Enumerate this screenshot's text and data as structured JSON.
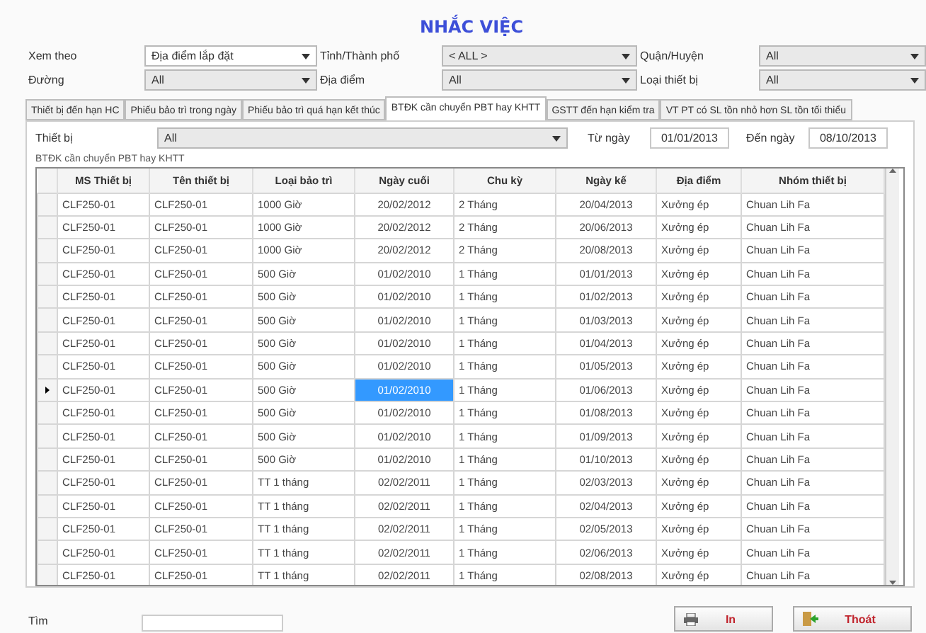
{
  "title": "NHẮC VIỆC",
  "filters": [
    {
      "label": "Xem theo",
      "value": "Địa điểm lắp đặt",
      "editable": true
    },
    {
      "label": "Tỉnh/Thành phố",
      "value": "< ALL >",
      "editable": false
    },
    {
      "label": "Quận/Huyện",
      "value": "All",
      "editable": false
    },
    {
      "label": "Đường",
      "value": "All",
      "editable": false
    },
    {
      "label": "Địa điểm",
      "value": "All",
      "editable": false
    },
    {
      "label": "Loại thiết bị",
      "value": "All",
      "editable": false
    }
  ],
  "tabs": [
    {
      "label": "Thiết bị đến hạn HC",
      "selected": false
    },
    {
      "label": "Phiếu bảo trì trong ngày",
      "selected": false
    },
    {
      "label": "Phiếu bảo trì quá hạn kết thúc",
      "selected": false
    },
    {
      "label": "BTĐK cần chuyển PBT hay KHTT",
      "selected": true
    },
    {
      "label": "GSTT đến hạn kiểm tra",
      "selected": false
    },
    {
      "label": "VT PT có SL tồn nhỏ hơn SL tồn tối thiểu",
      "selected": false
    }
  ],
  "panel": {
    "device_label": "Thiết bị",
    "device_value": "All",
    "from_label": "Từ ngày",
    "from_value": "01/01/2013",
    "to_label": "Đến ngày",
    "to_value": "08/10/2013",
    "group_label": "BTĐK cần chuyển PBT hay KHTT"
  },
  "table": {
    "columns": [
      {
        "label": "MS Thiết bị",
        "focused": false
      },
      {
        "label": "Tên thiết bị",
        "focused": false
      },
      {
        "label": "Loại bảo trì",
        "focused": false
      },
      {
        "label": "Ngày cuối",
        "focused": true
      },
      {
        "label": "Chu kỳ",
        "focused": false
      },
      {
        "label": "Ngày kế",
        "focused": false
      },
      {
        "label": "Địa điểm",
        "focused": false
      },
      {
        "label": "Nhóm thiết bị",
        "focused": false
      }
    ],
    "rows": [
      {
        "cells": [
          "CLF250-01",
          "CLF250-01",
          "1000 Giờ",
          "20/02/2012",
          "2 Tháng",
          "20/04/2013",
          "Xưởng ép",
          "Chuan Lih Fa"
        ],
        "selected": false
      },
      {
        "cells": [
          "CLF250-01",
          "CLF250-01",
          "1000 Giờ",
          "20/02/2012",
          "2 Tháng",
          "20/06/2013",
          "Xưởng ép",
          "Chuan Lih Fa"
        ],
        "selected": false
      },
      {
        "cells": [
          "CLF250-01",
          "CLF250-01",
          "1000 Giờ",
          "20/02/2012",
          "2 Tháng",
          "20/08/2013",
          "Xưởng ép",
          "Chuan Lih Fa"
        ],
        "selected": false
      },
      {
        "cells": [
          "CLF250-01",
          "CLF250-01",
          "500 Giờ",
          "01/02/2010",
          "1 Tháng",
          "01/01/2013",
          "Xưởng ép",
          "Chuan Lih Fa"
        ],
        "selected": false
      },
      {
        "cells": [
          "CLF250-01",
          "CLF250-01",
          "500 Giờ",
          "01/02/2010",
          "1 Tháng",
          "01/02/2013",
          "Xưởng ép",
          "Chuan Lih Fa"
        ],
        "selected": false
      },
      {
        "cells": [
          "CLF250-01",
          "CLF250-01",
          "500 Giờ",
          "01/02/2010",
          "1 Tháng",
          "01/03/2013",
          "Xưởng ép",
          "Chuan Lih Fa"
        ],
        "selected": false
      },
      {
        "cells": [
          "CLF250-01",
          "CLF250-01",
          "500 Giờ",
          "01/02/2010",
          "1 Tháng",
          "01/04/2013",
          "Xưởng ép",
          "Chuan Lih Fa"
        ],
        "selected": false
      },
      {
        "cells": [
          "CLF250-01",
          "CLF250-01",
          "500 Giờ",
          "01/02/2010",
          "1 Tháng",
          "01/05/2013",
          "Xưởng ép",
          "Chuan Lih Fa"
        ],
        "selected": false
      },
      {
        "cells": [
          "CLF250-01",
          "CLF250-01",
          "500 Giờ",
          "01/02/2010",
          "1 Tháng",
          "01/06/2013",
          "Xưởng ép",
          "Chuan Lih Fa"
        ],
        "selected": true
      },
      {
        "cells": [
          "CLF250-01",
          "CLF250-01",
          "500 Giờ",
          "01/02/2010",
          "1 Tháng",
          "01/08/2013",
          "Xưởng ép",
          "Chuan Lih Fa"
        ],
        "selected": false
      },
      {
        "cells": [
          "CLF250-01",
          "CLF250-01",
          "500 Giờ",
          "01/02/2010",
          "1 Tháng",
          "01/09/2013",
          "Xưởng ép",
          "Chuan Lih Fa"
        ],
        "selected": false
      },
      {
        "cells": [
          "CLF250-01",
          "CLF250-01",
          "500 Giờ",
          "01/02/2010",
          "1 Tháng",
          "01/10/2013",
          "Xưởng ép",
          "Chuan Lih Fa"
        ],
        "selected": false
      },
      {
        "cells": [
          "CLF250-01",
          "CLF250-01",
          "TT 1 tháng",
          "02/02/2011",
          "1 Tháng",
          "02/03/2013",
          "Xưởng ép",
          "Chuan Lih Fa"
        ],
        "selected": false
      },
      {
        "cells": [
          "CLF250-01",
          "CLF250-01",
          "TT 1 tháng",
          "02/02/2011",
          "1 Tháng",
          "02/04/2013",
          "Xưởng ép",
          "Chuan Lih Fa"
        ],
        "selected": false
      },
      {
        "cells": [
          "CLF250-01",
          "CLF250-01",
          "TT 1 tháng",
          "02/02/2011",
          "1 Tháng",
          "02/05/2013",
          "Xưởng ép",
          "Chuan Lih Fa"
        ],
        "selected": false
      },
      {
        "cells": [
          "CLF250-01",
          "CLF250-01",
          "TT 1 tháng",
          "02/02/2011",
          "1 Tháng",
          "02/06/2013",
          "Xưởng ép",
          "Chuan Lih Fa"
        ],
        "selected": false
      },
      {
        "cells": [
          "CLF250-01",
          "CLF250-01",
          "TT 1 tháng",
          "02/02/2011",
          "1 Tháng",
          "02/08/2013",
          "Xưởng ép",
          "Chuan Lih Fa"
        ],
        "selected": false
      }
    ]
  },
  "search": {
    "label": "Tìm"
  },
  "buttons": [
    {
      "label": "In",
      "kind": "print"
    },
    {
      "label": "Thoát",
      "kind": "exit"
    }
  ]
}
